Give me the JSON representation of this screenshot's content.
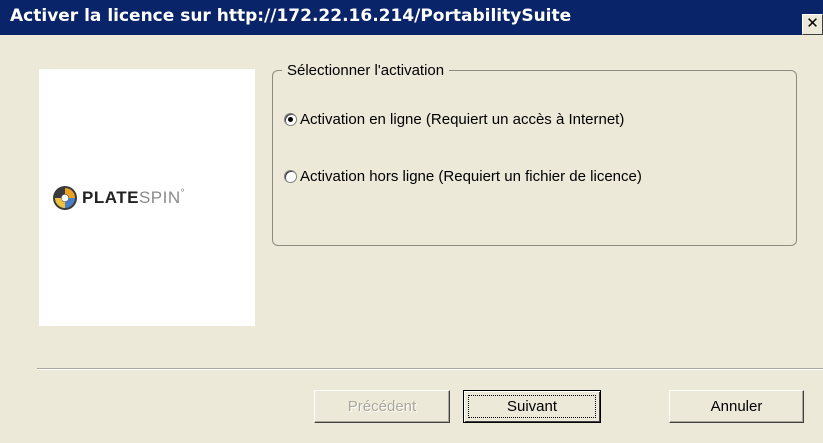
{
  "window": {
    "title": "Activer la licence sur http://172.22.16.214/PortabilitySuite",
    "close_glyph": "✕"
  },
  "logo": {
    "icon": "platespin-logo-icon",
    "text_plate": "PLATE",
    "text_spin": "SPIN",
    "mark": "°"
  },
  "activation": {
    "group_label": "Sélectionner l'activation",
    "options": [
      {
        "label": "Activation en ligne (Requiert un accès à Internet)",
        "checked": true
      },
      {
        "label": "Activation hors ligne (Requiert un fichier de licence)",
        "checked": false
      }
    ]
  },
  "buttons": {
    "previous": "Précédent",
    "next": "Suivant",
    "cancel": "Annuler"
  },
  "colors": {
    "titlebar": "#0a246a",
    "dialog_bg": "#ece9d8"
  }
}
